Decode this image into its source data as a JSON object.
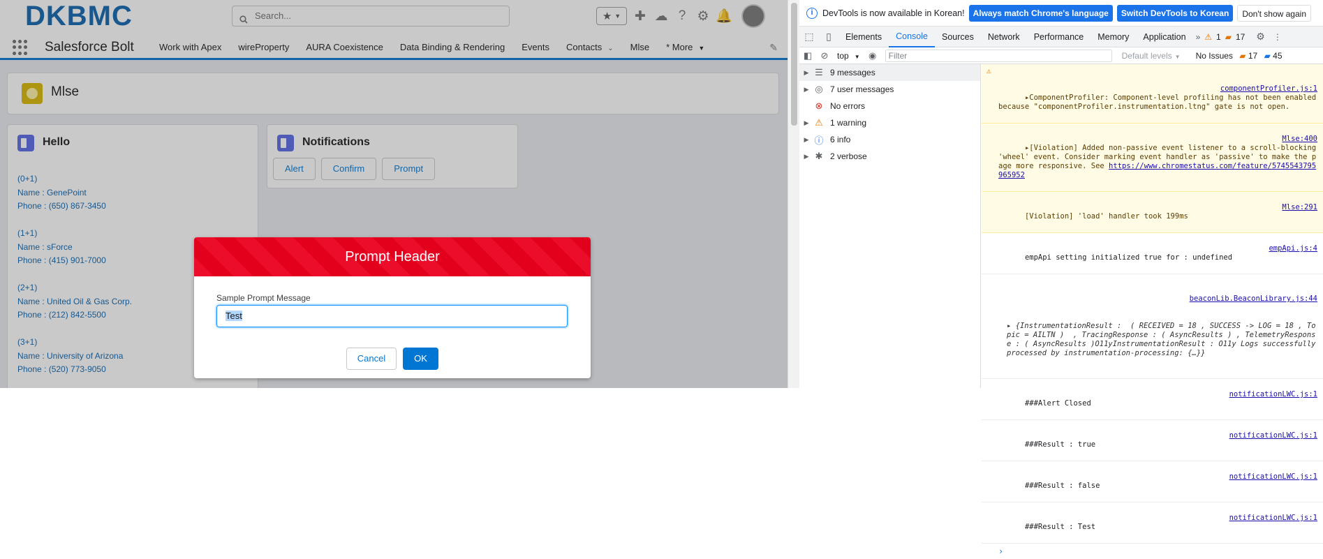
{
  "sf": {
    "logo": "DKBMC",
    "search_placeholder": "Search...",
    "app_name": "Salesforce Bolt",
    "tabs": [
      "Work with Apex",
      "wireProperty",
      "AURA Coexistence",
      "Data Binding & Rendering",
      "Events",
      "Contacts",
      "Mlse",
      "* More"
    ],
    "page_title": "Mlse",
    "hello_card": {
      "title": "Hello",
      "contacts": [
        {
          "index": "(0+1)",
          "name": "Name : GenePoint",
          "phone": "Phone : (650) 867-3450"
        },
        {
          "index": "(1+1)",
          "name": "Name : sForce",
          "phone": "Phone : (415) 901-7000"
        },
        {
          "index": "(2+1)",
          "name": "Name : United Oil & Gas Corp.",
          "phone": "Phone : (212) 842-5500"
        },
        {
          "index": "(3+1)",
          "name": "Name : University of Arizona",
          "phone": "Phone : (520) 773-9050"
        }
      ]
    },
    "notif_card": {
      "title": "Notifications",
      "buttons": [
        "Alert",
        "Confirm",
        "Prompt"
      ]
    },
    "modal": {
      "header": "Prompt Header",
      "label": "Sample Prompt Message",
      "value": "Test",
      "cancel": "Cancel",
      "ok": "OK"
    }
  },
  "devtools": {
    "banner": {
      "text": "DevTools is now available in Korean!",
      "btn1": "Always match Chrome's language",
      "btn2": "Switch DevTools to Korean",
      "btn3": "Don't show again"
    },
    "tabs": [
      "Elements",
      "Console",
      "Sources",
      "Network",
      "Performance",
      "Memory",
      "Application"
    ],
    "warn_count": "1",
    "issue_count": "17",
    "context": "top",
    "filter_placeholder": "Filter",
    "levels": "Default levels",
    "issues_label": "No Issues",
    "issues_a": "17",
    "issues_b": "45",
    "sidebar": [
      {
        "label": "9 messages",
        "icon": "list-icon",
        "arrow": true
      },
      {
        "label": "7 user messages",
        "icon": "user-icon",
        "arrow": true
      },
      {
        "label": "No errors",
        "icon": "error-icon",
        "arrow": false
      },
      {
        "label": "1 warning",
        "icon": "warning-icon",
        "arrow": true
      },
      {
        "label": "6 info",
        "icon": "info-icon",
        "arrow": true
      },
      {
        "label": "2 verbose",
        "icon": "bug-icon",
        "arrow": true
      }
    ],
    "messages": {
      "m1_text": "ComponentProfiler: Component-level profiling has not been enabled because \"componentProfiler.instrumentation.ltng\" gate is not open.",
      "m1_src": "componentProfiler.js:1",
      "m2_text": "[Violation] Added non-passive event listener to a scroll-blocking 'wheel' event. Consider marking event handler as 'passive' to make the page more responsive. See ",
      "m2_link": "https://www.chromestatus.com/feature/5745543795965952",
      "m2_src": "Mlse:400",
      "m3_text": "[Violation] 'load' handler took 199ms",
      "m3_src": "Mlse:291",
      "m4_text": "empApi setting initialized true for : undefined",
      "m4_src": "empApi.js:4",
      "m5_src": "beaconLib.BeaconLibrary.js:44",
      "m5_text": "{InstrumentationResult :  ( RECEIVED = 18 , SUCCESS -> LOG = 18 , Topic = AILTN )  , TracingResponse : ( AsyncResults ) , TelemetryResponse : ( AsyncResults )O11yInstrumentationResult : O11y Logs successfully processed by instrumentation-processing: {…}}",
      "m6_text": "###Alert Closed",
      "m7_text": "###Result : true",
      "m8_text": "###Result : false",
      "m9_text": "###Result : Test",
      "notif_src": "notificationLWC.js:1"
    }
  }
}
